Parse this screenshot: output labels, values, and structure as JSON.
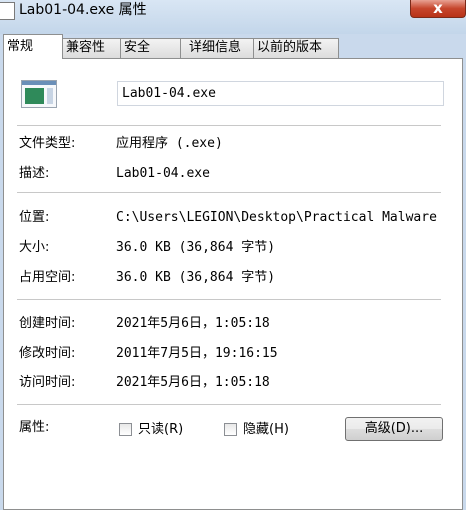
{
  "window": {
    "title": "Lab01-04.exe 属性",
    "close_label": "x"
  },
  "tabs": [
    {
      "label": "常规",
      "active": true
    },
    {
      "label": "兼容性"
    },
    {
      "label": "安全"
    },
    {
      "label": "详细信息"
    },
    {
      "label": "以前的版本"
    }
  ],
  "general": {
    "file_name": "Lab01-04.exe",
    "file_type_label": "文件类型:",
    "file_type_value": "应用程序 (.exe)",
    "description_label": "描述:",
    "description_value": "Lab01-04.exe",
    "location_label": "位置:",
    "location_value": "C:\\Users\\LEGION\\Desktop\\Practical Malware",
    "size_label": "大小:",
    "size_value": "36.0 KB (36,864 字节)",
    "size_on_disk_label": "占用空间:",
    "size_on_disk_value": "36.0 KB (36,864 字节)",
    "created_label": "创建时间:",
    "created_value": "2021年5月6日，1:05:18",
    "modified_label": "修改时间:",
    "modified_value": "2011年7月5日，19:16:15",
    "accessed_label": "访问时间:",
    "accessed_value": "2021年5月6日，1:05:18",
    "attributes_label": "属性:",
    "readonly_label": "只读(R)",
    "readonly_checked": false,
    "hidden_label": "隐藏(H)",
    "hidden_checked": false,
    "advanced_label": "高级(D)..."
  },
  "icons": {
    "title_icon": "file-icon",
    "app_icon": "application-icon"
  }
}
